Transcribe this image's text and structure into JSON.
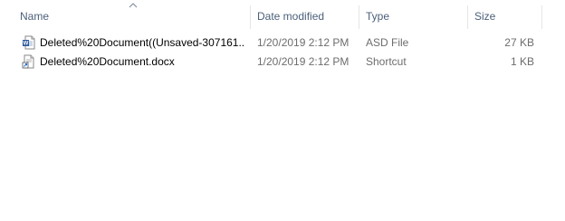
{
  "columns": {
    "name": "Name",
    "date_modified": "Date modified",
    "type": "Type",
    "size": "Size"
  },
  "sort": {
    "column": "name",
    "direction": "ascending"
  },
  "files": [
    {
      "name": "Deleted%20Document((Unsaved-307161...",
      "date_modified": "1/20/2019 2:12 PM",
      "type": "ASD File",
      "size": "27 KB",
      "icon": "word-document-icon"
    },
    {
      "name": "Deleted%20Document.docx",
      "date_modified": "1/20/2019 2:12 PM",
      "type": "Shortcut",
      "size": "1 KB",
      "icon": "shortcut-document-icon"
    }
  ],
  "colors": {
    "header_text": "#4c607a",
    "secondary_text": "#6d6d6d",
    "word_blue": "#2b579a"
  }
}
